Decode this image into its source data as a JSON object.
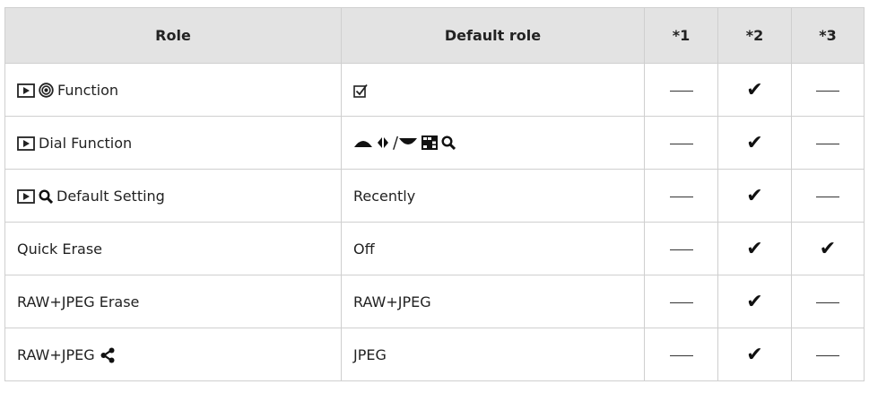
{
  "headers": [
    "Role",
    "Default role",
    "*1",
    "*2",
    "*3"
  ],
  "marks": {
    "check": "✔",
    "dash": "—"
  },
  "rows": [
    {
      "role": "Function",
      "role_icons": [
        "playback-icon",
        "target-icon"
      ],
      "default": "",
      "default_icons": [
        "checkbox-icon"
      ],
      "c1": "dash",
      "c2": "check",
      "c3": "dash"
    },
    {
      "role": "Dial Function",
      "role_icons": [
        "playback-icon"
      ],
      "default": "",
      "default_icons": [
        "front-dial-icon",
        "left-right-arrow-icon",
        "rear-dial-icon",
        "grid-icon",
        "magnify-icon"
      ],
      "default_sep": "/",
      "c1": "dash",
      "c2": "check",
      "c3": "dash"
    },
    {
      "role": "Default Setting",
      "role_icons": [
        "playback-icon",
        "magnify-icon"
      ],
      "default": "Recently",
      "c1": "dash",
      "c2": "check",
      "c3": "dash"
    },
    {
      "role": "Quick Erase",
      "default": "Off",
      "c1": "dash",
      "c2": "check",
      "c3": "check"
    },
    {
      "role": "RAW+JPEG Erase",
      "default": "RAW+JPEG",
      "c1": "dash",
      "c2": "check",
      "c3": "dash"
    },
    {
      "role": "RAW+JPEG",
      "role_icons_after": [
        "share-icon"
      ],
      "default": "JPEG",
      "c1": "dash",
      "c2": "check",
      "c3": "dash"
    }
  ]
}
